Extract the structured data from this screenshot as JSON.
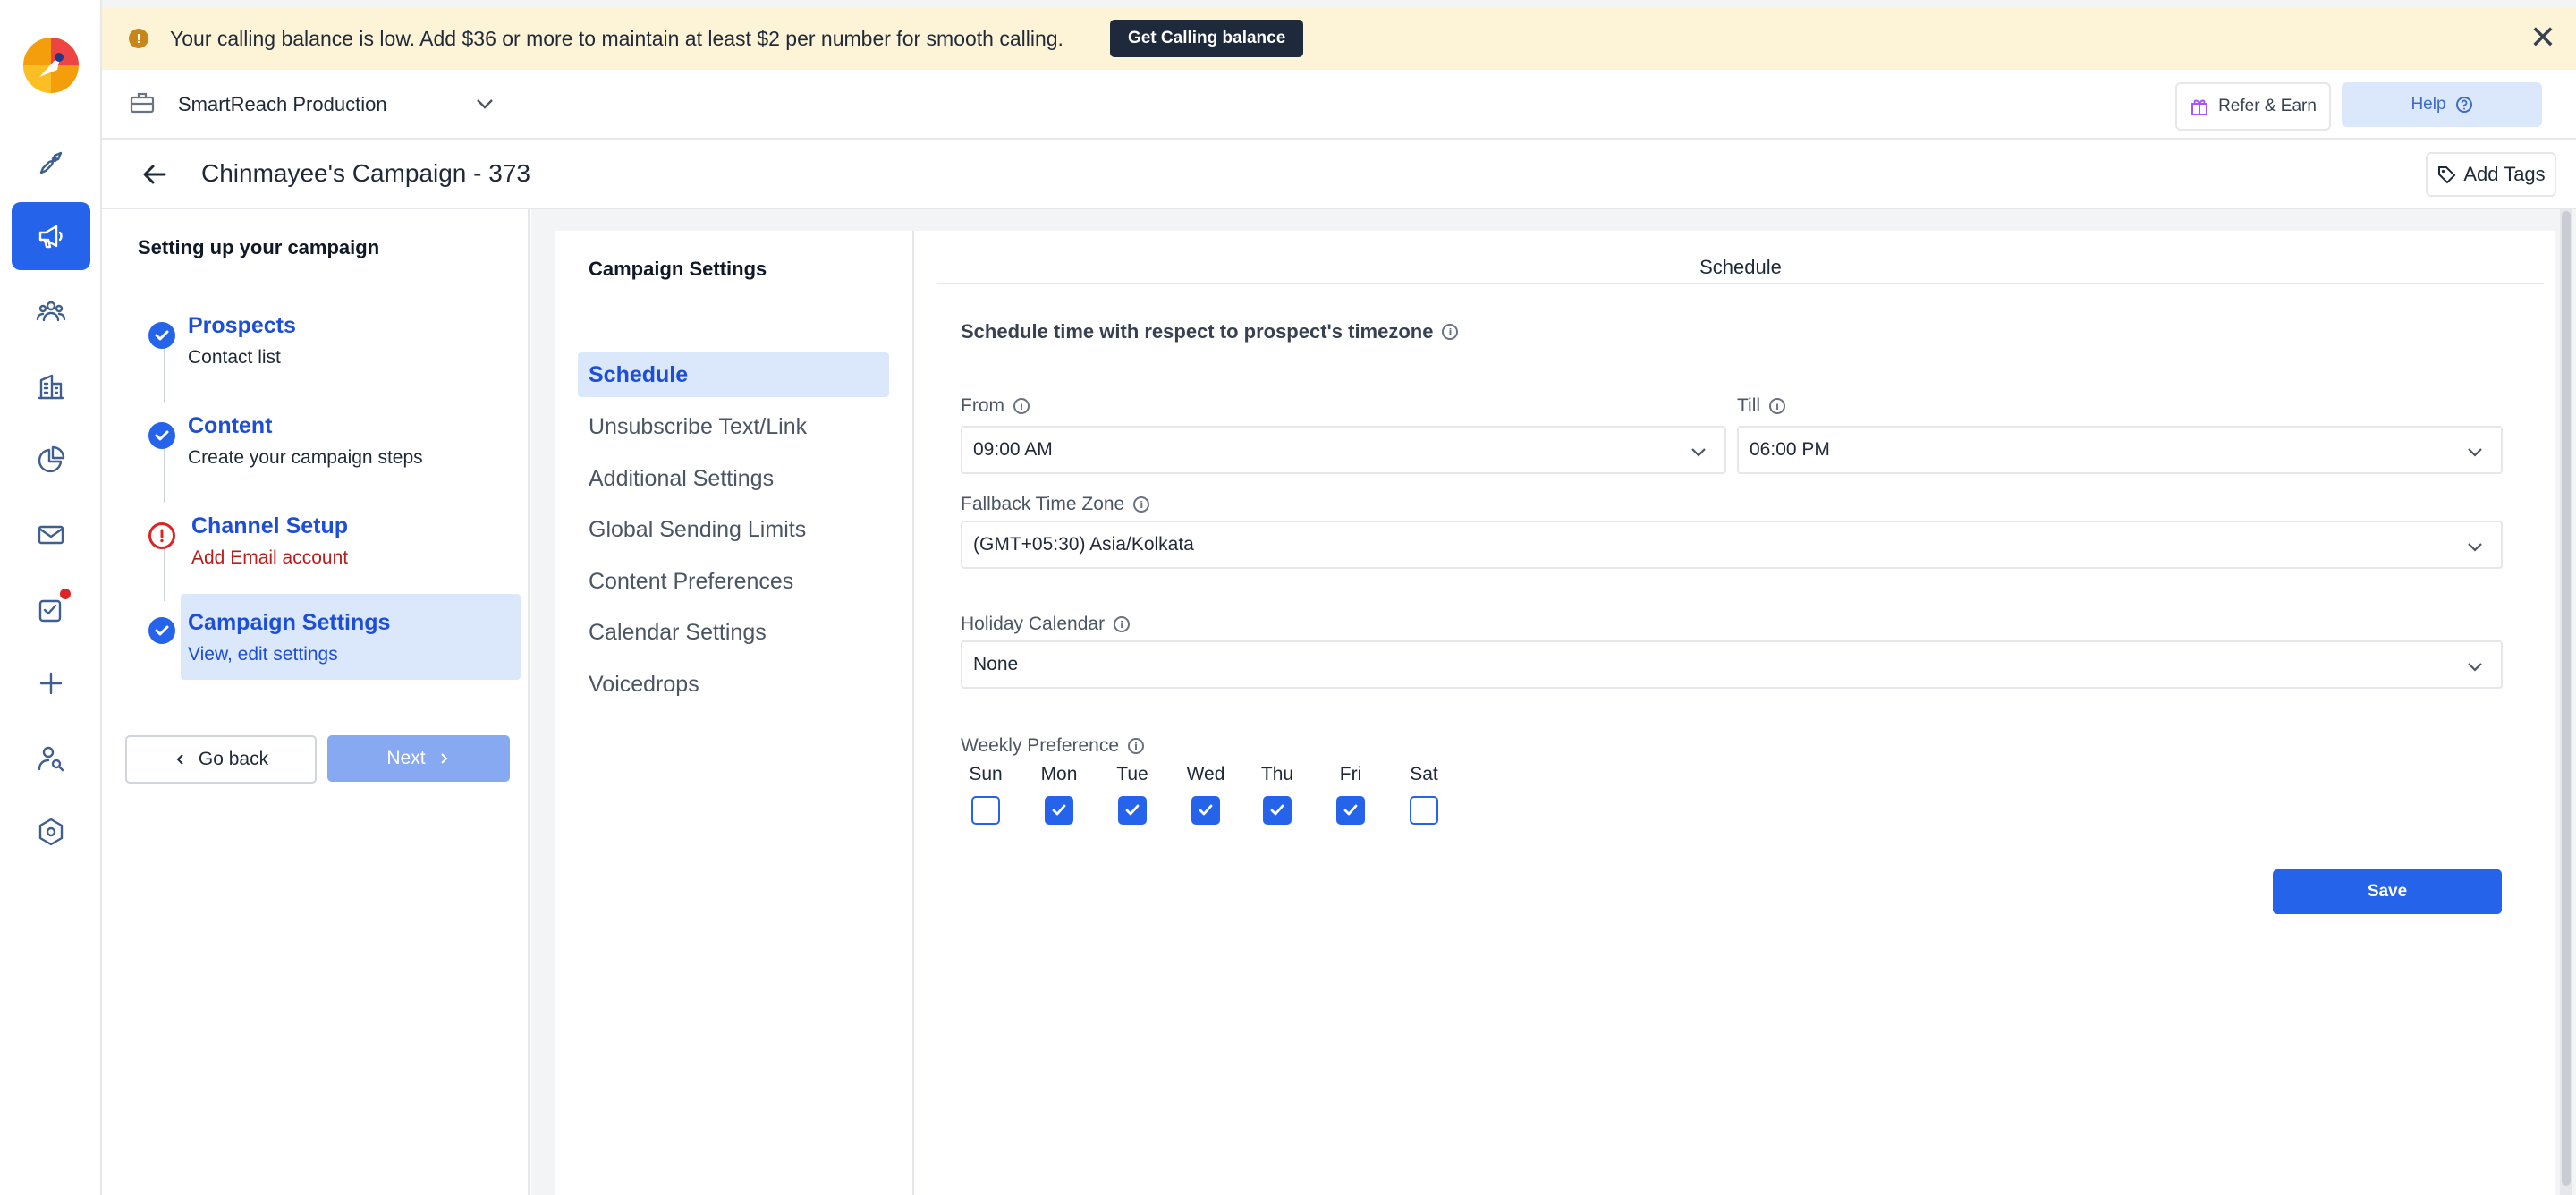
{
  "banner": {
    "message": "Your calling balance is low. Add $36 or more to maintain at least $2 per number for smooth calling.",
    "cta_label": "Get Calling balance",
    "warning_glyph": "!",
    "close_glyph": "✕"
  },
  "header": {
    "workspace": "SmartReach Production",
    "refer_label": "Refer & Earn",
    "help_label": "Help"
  },
  "campaign": {
    "title": "Chinmayee's Campaign - 373",
    "add_tags_label": "Add Tags"
  },
  "stepper": {
    "heading": "Setting up your campaign",
    "steps": [
      {
        "name": "Prospects",
        "sub": "Contact list",
        "status": "done"
      },
      {
        "name": "Content",
        "sub": "Create your campaign steps",
        "status": "done"
      },
      {
        "name": "Channel Setup",
        "sub": "Add Email account",
        "status": "error"
      },
      {
        "name": "Campaign Settings",
        "sub": "View, edit settings",
        "status": "done"
      }
    ],
    "go_back_label": "Go back",
    "next_label": "Next"
  },
  "settings_menu": {
    "heading": "Campaign Settings",
    "items": [
      "Schedule",
      "Unsubscribe Text/Link",
      "Additional Settings",
      "Global Sending Limits",
      "Content Preferences",
      "Calendar Settings",
      "Voicedrops"
    ]
  },
  "schedule": {
    "panel_title": "Schedule",
    "section_label": "Schedule time with respect to prospect's timezone",
    "from_label": "From",
    "from_value": "09:00 AM",
    "till_label": "Till",
    "till_value": "06:00 PM",
    "fallback_label": "Fallback Time Zone",
    "fallback_value": "(GMT+05:30) Asia/Kolkata",
    "holiday_label": "Holiday Calendar",
    "holiday_value": "None",
    "weekly_label": "Weekly Preference",
    "days": [
      {
        "label": "Sun",
        "checked": false
      },
      {
        "label": "Mon",
        "checked": true
      },
      {
        "label": "Tue",
        "checked": true
      },
      {
        "label": "Wed",
        "checked": true
      },
      {
        "label": "Thu",
        "checked": true
      },
      {
        "label": "Fri",
        "checked": true
      },
      {
        "label": "Sat",
        "checked": false
      }
    ],
    "save_label": "Save"
  },
  "sidebar_icons": [
    "rocket-icon",
    "megaphone-icon",
    "team-icon",
    "building-icon",
    "pie-chart-icon",
    "mail-icon",
    "task-icon",
    "plus-icon",
    "user-search-icon",
    "settings-hexagon-icon"
  ],
  "colors": {
    "accent": "#2563eb",
    "banner_bg": "#fdf4d8",
    "error": "#dc2626",
    "active_bg": "#dbe7fb"
  }
}
